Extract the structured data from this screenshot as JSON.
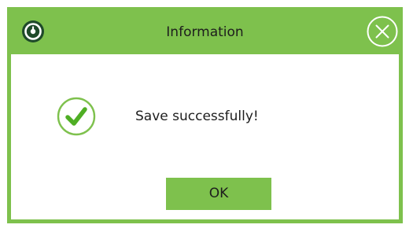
{
  "dialog": {
    "title": "Information",
    "message": "Save successfully!",
    "ok_label": "OK"
  },
  "icons": {
    "app": "clock-icon",
    "close": "close-icon",
    "status": "checkmark-success-icon"
  },
  "colors": {
    "accent": "#7ec14d",
    "check": "#4fae24",
    "text": "#1d1d1d",
    "background": "#ffffff"
  }
}
